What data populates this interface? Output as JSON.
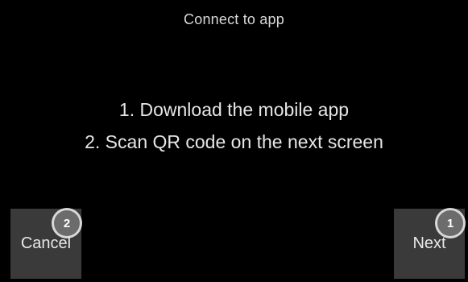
{
  "screen": {
    "title": "Connect to app",
    "instructions": [
      "1. Download the mobile app",
      "2. Scan QR code on the next screen"
    ]
  },
  "buttons": {
    "cancel": {
      "label": "Cancel",
      "key_number": "2"
    },
    "next": {
      "label": "Next",
      "key_number": "1"
    }
  },
  "colors": {
    "background": "#000000",
    "text": "#e6e6e6",
    "button_bg": "#3a3a3a",
    "badge_ring": "#ebebeb"
  }
}
